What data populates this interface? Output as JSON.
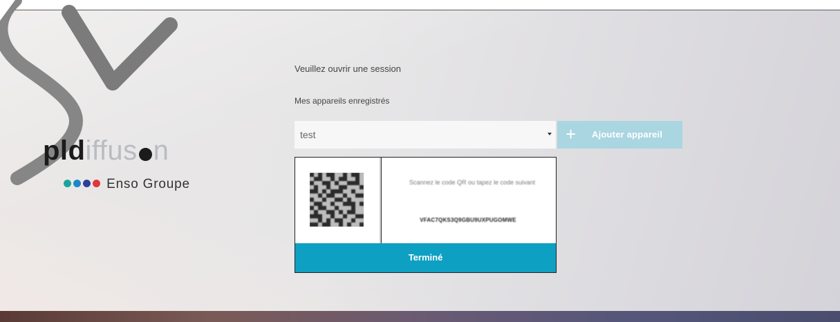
{
  "logo": {
    "brand_bold": "pld",
    "brand_light_1": "iffus",
    "brand_light_2": "n",
    "sub_label": "Enso Groupe",
    "dots": [
      "#1aa59a",
      "#1c87c9",
      "#2d3f9c",
      "#e0373b"
    ]
  },
  "login": {
    "title": "Veuillez ouvrir une session",
    "devices_label": "Mes appareils enregistrés",
    "device_select": {
      "value": "test"
    },
    "add_device_label": "Ajouter appareil",
    "add_icon": "plus-icon"
  },
  "qr_panel": {
    "instruction": "Scannez le code QR ou tapez le code suivant",
    "code": "VFAC7QKS3Q9GBU9UXPUGOMWE",
    "done_label": "Terminé"
  },
  "colors": {
    "accent": "#0ea0c3",
    "accent_light": "#a9d6e0"
  }
}
